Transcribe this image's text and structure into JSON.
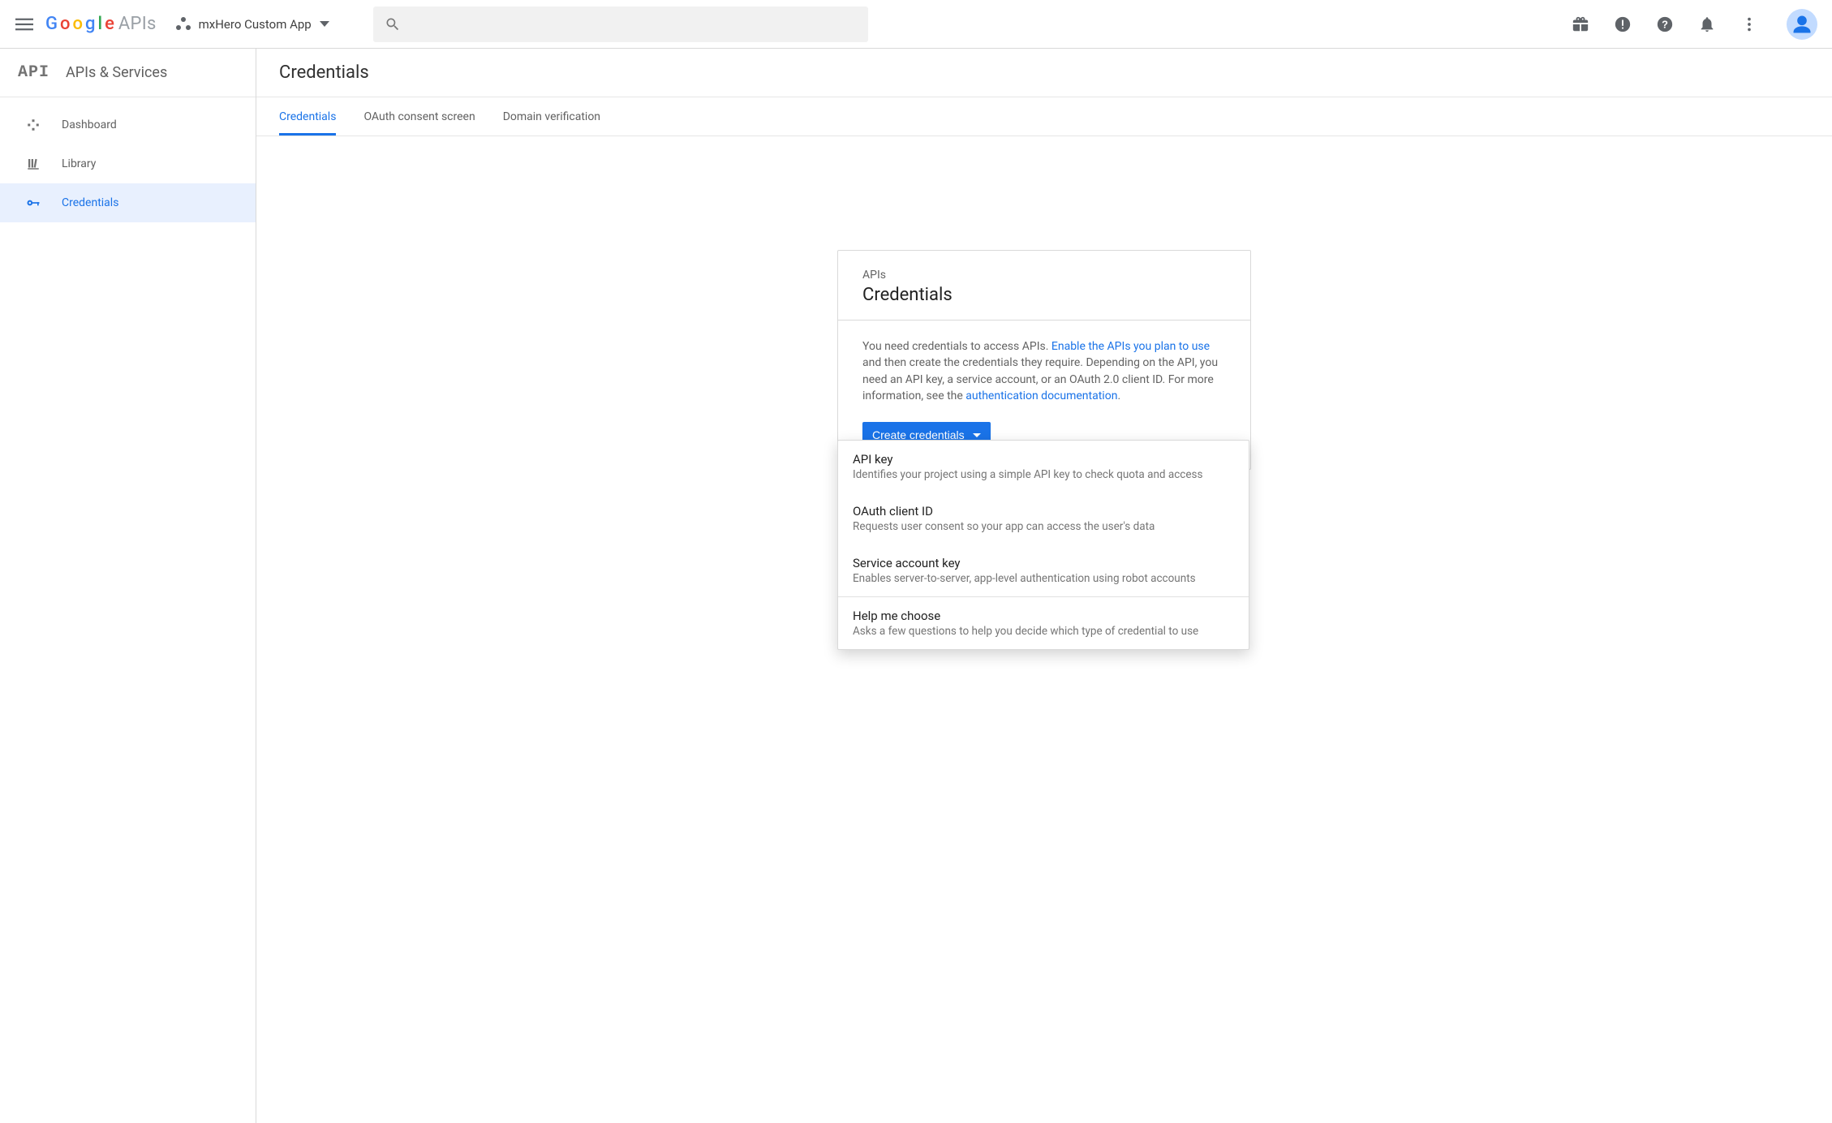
{
  "appbar": {
    "project_name": "mxHero Custom App",
    "search_placeholder": ""
  },
  "sidebar": {
    "section_title": "APIs & Services",
    "items": [
      {
        "label": "Dashboard",
        "icon": "dashboard-icon",
        "active": false
      },
      {
        "label": "Library",
        "icon": "library-icon",
        "active": false
      },
      {
        "label": "Credentials",
        "icon": "key-icon",
        "active": true
      }
    ]
  },
  "page": {
    "title": "Credentials",
    "tabs": [
      {
        "label": "Credentials",
        "active": true
      },
      {
        "label": "OAuth consent screen",
        "active": false
      },
      {
        "label": "Domain verification",
        "active": false
      }
    ]
  },
  "card": {
    "eyebrow": "APIs",
    "title": "Credentials",
    "text_before_link1": "You need credentials to access APIs. ",
    "link1": "Enable the APIs you plan to use",
    "text_between": " and then create the credentials they require. Depending on the API, you need an API key, a service account, or an OAuth 2.0 client ID. For more information, see the ",
    "link2": "authentication documentation",
    "text_after_link2": ".",
    "button_label": "Create credentials"
  },
  "menu": {
    "items": [
      {
        "title": "API key",
        "desc": "Identifies your project using a simple API key to check quota and access"
      },
      {
        "title": "OAuth client ID",
        "desc": "Requests user consent so your app can access the user's data"
      },
      {
        "title": "Service account key",
        "desc": "Enables server-to-server, app-level authentication using robot accounts"
      }
    ],
    "footer": {
      "title": "Help me choose",
      "desc": "Asks a few questions to help you decide which type of credential to use"
    }
  },
  "colors": {
    "accent": "#1a73e8"
  }
}
